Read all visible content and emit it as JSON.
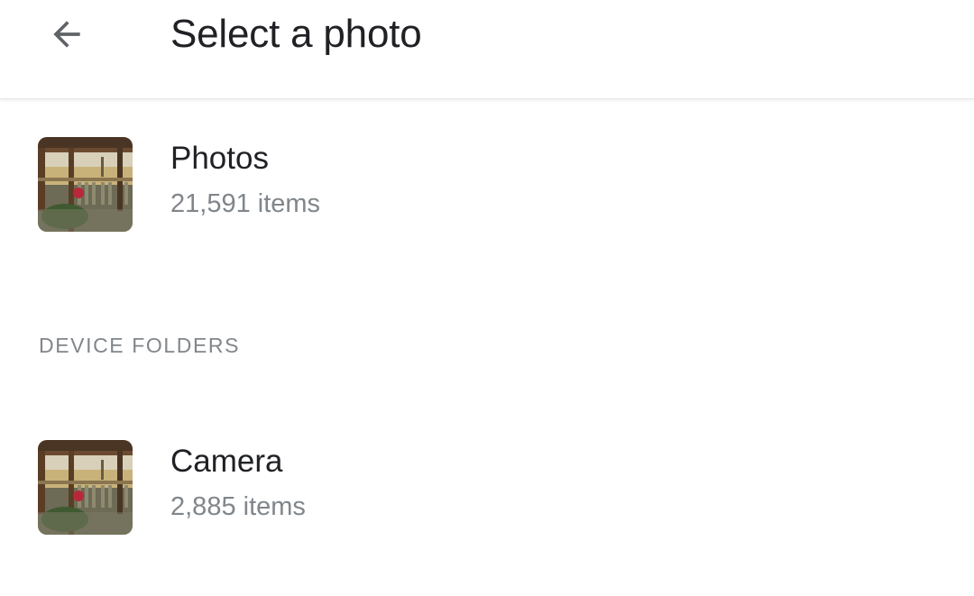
{
  "header": {
    "title": "Select a photo",
    "back_icon": "arrow-back-icon"
  },
  "albums": [
    {
      "name": "Photos",
      "count": "21,591 items",
      "thumbnail": "porch-photo-thumbnail"
    }
  ],
  "device_folders": {
    "header": "DEVICE FOLDERS",
    "items": [
      {
        "name": "Camera",
        "count": "2,885 items",
        "thumbnail": "porch-photo-thumbnail"
      }
    ]
  },
  "colors": {
    "primary_text": "#202124",
    "secondary_text": "#80868b",
    "icon": "#5f6368",
    "background": "#ffffff"
  }
}
